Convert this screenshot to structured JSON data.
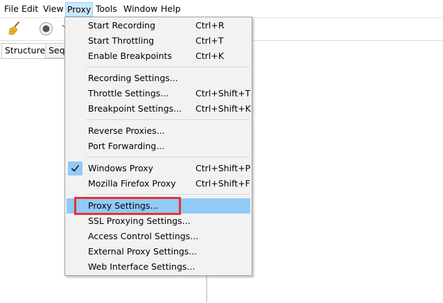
{
  "menubar": {
    "items": [
      {
        "label": "File"
      },
      {
        "label": "Edit"
      },
      {
        "label": "View"
      },
      {
        "label": "Proxy"
      },
      {
        "label": "Tools"
      },
      {
        "label": "Window"
      },
      {
        "label": "Help"
      }
    ]
  },
  "toolbar": {
    "icons": [
      "broom-icon",
      "record-icon"
    ]
  },
  "tabs": [
    {
      "label": "Structure"
    },
    {
      "label": "Seq"
    }
  ],
  "proxy_menu": {
    "items": [
      {
        "label": "Start Recording",
        "shortcut": "Ctrl+R"
      },
      {
        "label": "Start Throttling",
        "shortcut": "Ctrl+T"
      },
      {
        "label": "Enable Breakpoints",
        "shortcut": "Ctrl+K"
      },
      {
        "label": "Recording Settings...",
        "shortcut": ""
      },
      {
        "label": "Throttle Settings...",
        "shortcut": "Ctrl+Shift+T"
      },
      {
        "label": "Breakpoint Settings...",
        "shortcut": "Ctrl+Shift+K"
      },
      {
        "label": "Reverse Proxies...",
        "shortcut": ""
      },
      {
        "label": "Port Forwarding...",
        "shortcut": ""
      },
      {
        "label": "Windows Proxy",
        "shortcut": "Ctrl+Shift+P",
        "checked": true
      },
      {
        "label": "Mozilla Firefox Proxy",
        "shortcut": "Ctrl+Shift+F"
      },
      {
        "label": "Proxy Settings...",
        "shortcut": "",
        "highlighted": true
      },
      {
        "label": "SSL Proxying Settings...",
        "shortcut": ""
      },
      {
        "label": "Access Control Settings...",
        "shortcut": ""
      },
      {
        "label": "External Proxy Settings...",
        "shortcut": ""
      },
      {
        "label": "Web Interface Settings...",
        "shortcut": ""
      }
    ]
  },
  "colors": {
    "highlight": "#91c9f7",
    "menu_active": "#cce8ff",
    "annotation_red": "#e8312f"
  }
}
